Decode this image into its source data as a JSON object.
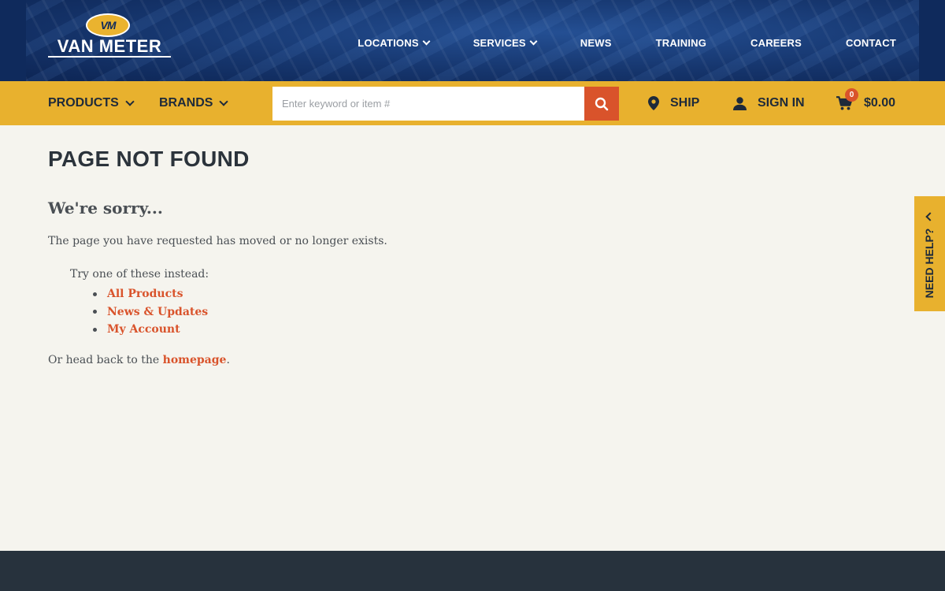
{
  "brand": {
    "logo_badge": "VM",
    "logo_name": "VAN METER"
  },
  "top_nav": {
    "items": [
      {
        "label": "LOCATIONS",
        "dropdown": true
      },
      {
        "label": "SERVICES",
        "dropdown": true
      },
      {
        "label": "NEWS"
      },
      {
        "label": "TRAINING"
      },
      {
        "label": "CAREERS"
      },
      {
        "label": "CONTACT"
      }
    ]
  },
  "secondary_nav": {
    "products_label": "PRODUCTS",
    "brands_label": "BRANDS",
    "search_placeholder": "Enter keyword or item #",
    "search_value": "",
    "ship_label": "SHIP",
    "signin_label": "SIGN IN",
    "cart_count": "0",
    "cart_total": "$0.00"
  },
  "content": {
    "title": "PAGE NOT FOUND",
    "subtitle": "We're sorry...",
    "message": "The page you have requested has moved or no longer exists.",
    "try_text": "Try one of these instead:",
    "links": [
      "All Products",
      "News & Updates",
      "My Account"
    ],
    "back_prefix": "Or head back to the ",
    "back_link": "homepage",
    "back_suffix": "."
  },
  "help_tab": {
    "label": "NEED HELP?"
  },
  "colors": {
    "navy": "#0f2a5c",
    "gold": "#e8b12e",
    "accent_orange": "#d9532b",
    "background": "#f5f4ee",
    "footer": "#27323d"
  }
}
